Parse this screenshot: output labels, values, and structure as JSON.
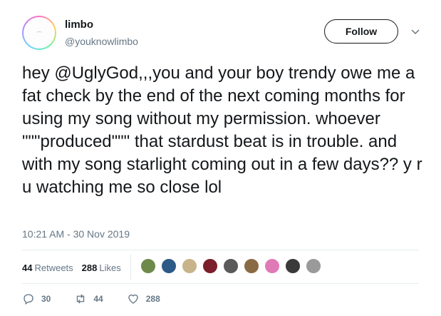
{
  "user": {
    "name": "limbo",
    "handle": "@youknowlimbo",
    "follow_label": "Follow"
  },
  "tweet": {
    "text": "hey @UglyGod,,,you and your boy trendy owe me a fat check by the end of the next coming months for using my song without my permission. whoever \"\"\"produced\"\"\" that stardust beat is in trouble. and with my song starlight coming out in a few days?? y r u watching me so close lol",
    "timestamp": "10:21 AM - 30 Nov 2019"
  },
  "stats": {
    "retweets_count": "44",
    "retweets_label": "Retweets",
    "likes_count": "288",
    "likes_label": "Likes"
  },
  "likers": [
    {
      "color": "#6e8a4a"
    },
    {
      "color": "#2d5a86"
    },
    {
      "color": "#c7b48a"
    },
    {
      "color": "#7a1f2b"
    },
    {
      "color": "#5a5a5a"
    },
    {
      "color": "#8a6a44"
    },
    {
      "color": "#e07ab6"
    },
    {
      "color": "#3a3a3a"
    },
    {
      "color": "#9a9a9a"
    }
  ],
  "actions": {
    "reply_count": "30",
    "retweet_count": "44",
    "like_count": "288"
  },
  "icons": {
    "reply": "reply-icon",
    "retweet": "retweet-icon",
    "like": "heart-icon",
    "more": "chevron-down-icon"
  },
  "colors": {
    "text": "#14171a",
    "secondary": "#657786",
    "divider": "#e6ecf0"
  }
}
